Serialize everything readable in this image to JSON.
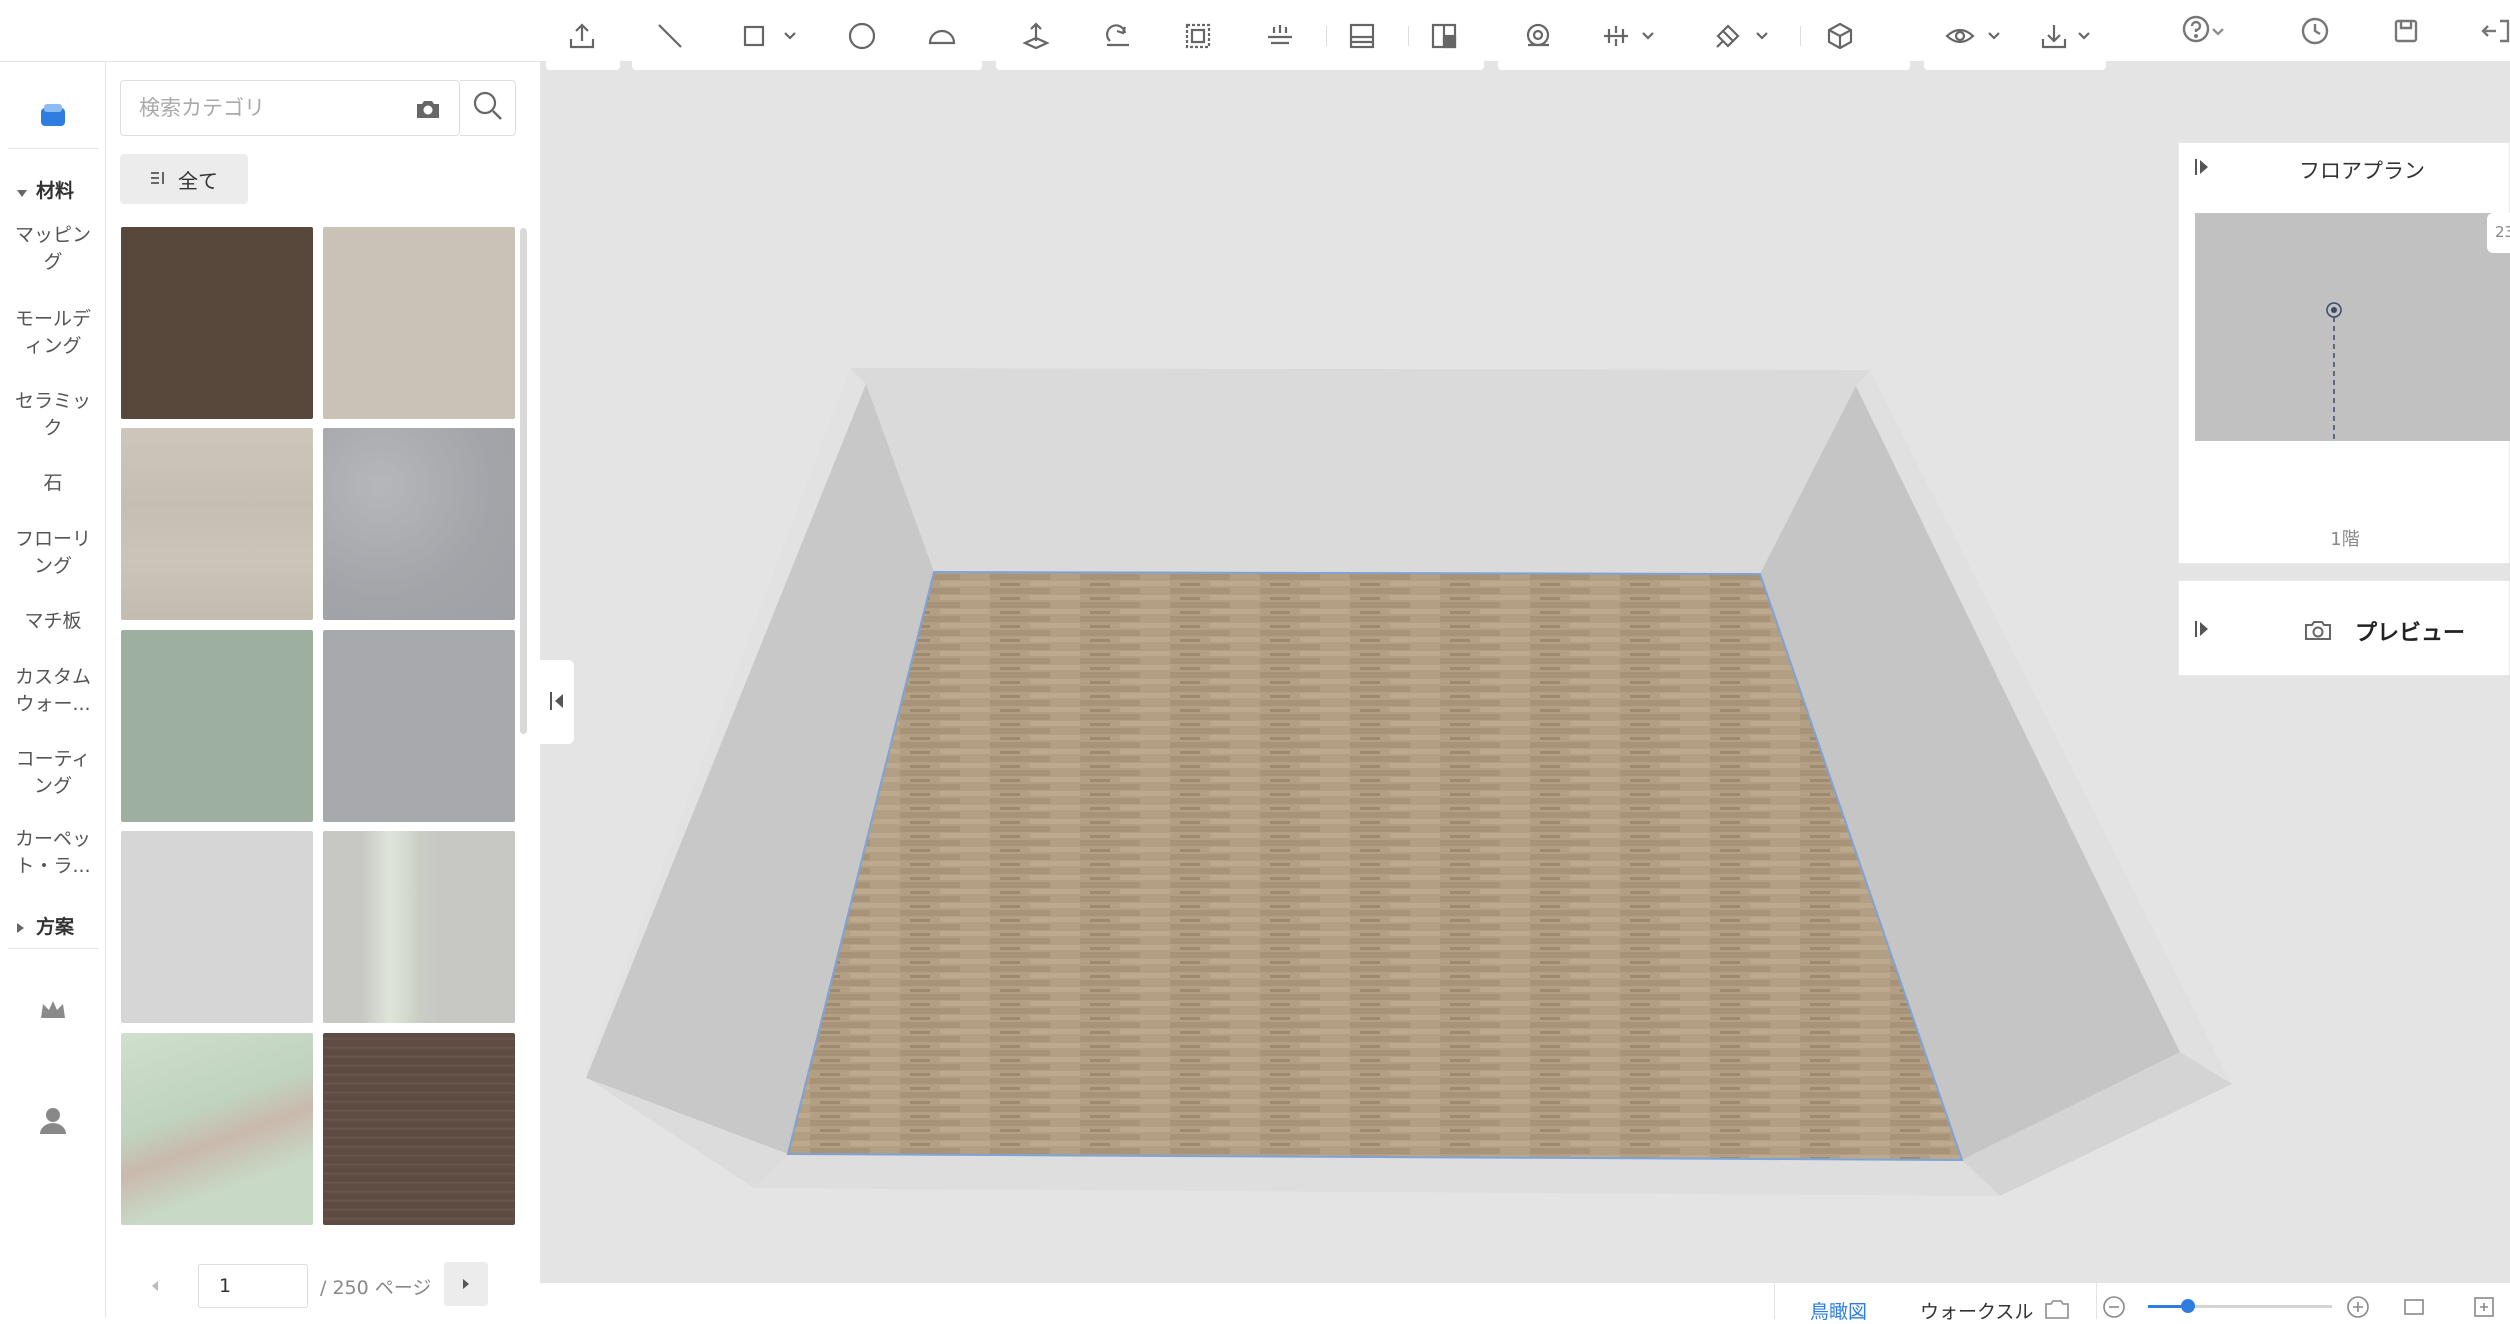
{
  "toolbar_top": {
    "icons": [
      "undo-icon",
      "redo-icon",
      "eraser-icon",
      "help-icon",
      "history-icon",
      "save-icon",
      "exit-icon"
    ]
  },
  "rail": {
    "sections": {
      "materials": "材料",
      "plans": "方案"
    },
    "items": [
      {
        "label": "マッピン\nグ"
      },
      {
        "label": "モールデ\nィング"
      },
      {
        "label": "セラミッ\nク"
      },
      {
        "label": "石"
      },
      {
        "label": "フローリ\nング"
      },
      {
        "label": "マチ板"
      },
      {
        "label": "カスタム\nウォー..."
      },
      {
        "label": "コーティ\nング"
      },
      {
        "label": "カーペッ\nト・ラ..."
      }
    ]
  },
  "panel": {
    "search_placeholder": "検索カテゴリ",
    "all_button": "全て",
    "swatch_colors": [
      "#57483b",
      "#cbc2b7",
      "#c8c2b6",
      "#a9abb0",
      "#9daf9f",
      "#a8a9ad",
      "#d6d6d6",
      "#c7c8c4",
      "#c6d6c4",
      "#5e4c44"
    ],
    "pager": {
      "current_page": "1",
      "total_label": "/ 250 ページ"
    }
  },
  "floorplan": {
    "title": "フロアプラン",
    "floor_label": "1階",
    "edge_label": "23"
  },
  "preview": {
    "title": "プレビュー"
  },
  "bottom": {
    "birdseye": "鳥瞰図",
    "walkthrough": "ウォークスル",
    "zoom_level": 0.22
  },
  "colors": {
    "accent": "#2f7de1",
    "floor": "#b29f84",
    "viewport_bg": "#e4e4e5"
  }
}
